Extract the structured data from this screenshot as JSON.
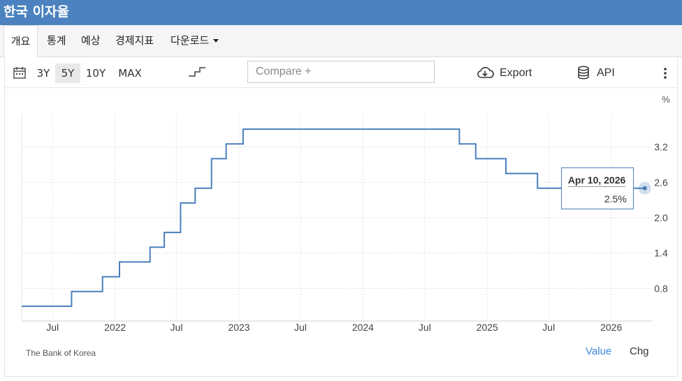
{
  "header": {
    "title": "한국 이자율"
  },
  "tabs": [
    "개요",
    "통계",
    "예상",
    "경제지표",
    "다운로드"
  ],
  "toolbar": {
    "ranges": [
      "3Y",
      "5Y",
      "10Y",
      "MAX"
    ],
    "selected_range": "5Y",
    "compare_placeholder": "Compare +",
    "export_label": "Export",
    "api_label": "API"
  },
  "tooltip": {
    "date": "Apr 10, 2026",
    "value": "2.5%"
  },
  "footer": {
    "source": "The Bank of Korea",
    "value_label": "Value",
    "chg_label": "Chg"
  },
  "colors": {
    "header": "#4b82bf",
    "line": "#4a7fbd",
    "link": "#3b8ad6"
  },
  "chart_data": {
    "type": "line",
    "step": true,
    "unit": "%",
    "ylim": [
      0.25,
      3.75
    ],
    "yticks": [
      0.8,
      1.4,
      2.0,
      2.6,
      3.2
    ],
    "ytick_labels": [
      "0.8",
      "1.4",
      "2.0",
      "2.6",
      "3.2"
    ],
    "xlim": [
      "2021-04-01",
      "2026-05-01"
    ],
    "xticks": [
      "2021-07-01",
      "2022-01-01",
      "2022-07-01",
      "2023-01-01",
      "2023-07-01",
      "2024-01-01",
      "2024-07-01",
      "2025-01-01",
      "2025-07-01",
      "2026-01-01"
    ],
    "xtick_labels": [
      "Jul",
      "2022",
      "Jul",
      "2023",
      "Jul",
      "2024",
      "Jul",
      "2025",
      "Jul",
      "2026"
    ],
    "grid": true,
    "series": [
      {
        "x": [
          "2021-04-01",
          "2021-08-26",
          "2021-11-25",
          "2022-01-14",
          "2022-04-14",
          "2022-05-26",
          "2022-07-13",
          "2022-08-25",
          "2022-10-12",
          "2022-11-24",
          "2023-01-13",
          "2024-10-11",
          "2024-11-28",
          "2025-02-25",
          "2025-05-29",
          "2026-04-10"
        ],
        "values": [
          0.5,
          0.75,
          1.0,
          1.25,
          1.5,
          1.75,
          2.25,
          2.5,
          3.0,
          3.25,
          3.5,
          3.25,
          3.0,
          2.75,
          2.5,
          2.5
        ]
      }
    ]
  }
}
